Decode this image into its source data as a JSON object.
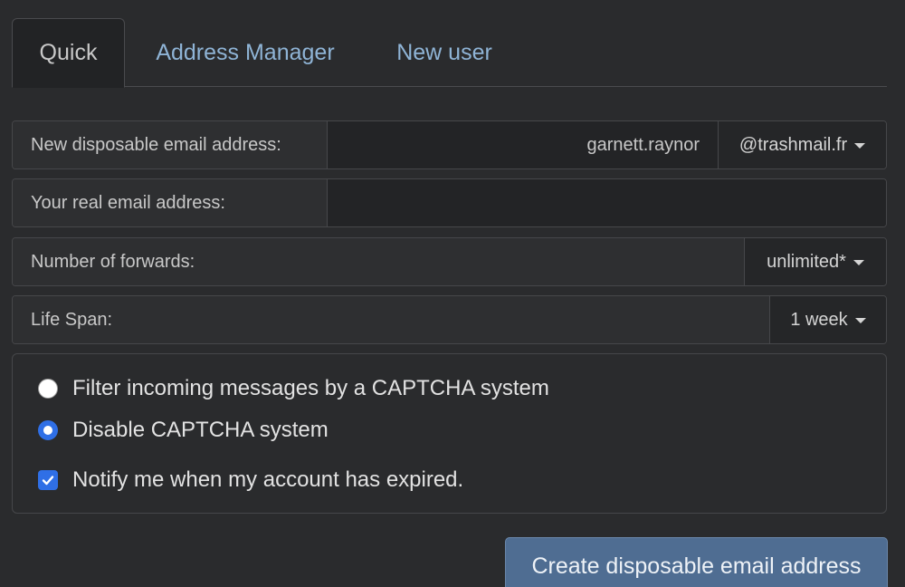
{
  "tabs": [
    {
      "label": "Quick",
      "active": true
    },
    {
      "label": "Address Manager",
      "active": false
    },
    {
      "label": "New user",
      "active": false
    }
  ],
  "form": {
    "disposable": {
      "label": "New disposable email address:",
      "value": "garnett.raynor",
      "domain": "@trashmail.fr"
    },
    "real_email": {
      "label": "Your real email address:",
      "value": "",
      "placeholder": ""
    },
    "forwards": {
      "label": "Number of forwards:",
      "value": "unlimited*"
    },
    "lifespan": {
      "label": "Life Span:",
      "value": "1 week"
    }
  },
  "options": {
    "captcha_filter": {
      "label": "Filter incoming messages by a CAPTCHA system",
      "checked": false
    },
    "captcha_disable": {
      "label": "Disable CAPTCHA system",
      "checked": true
    },
    "notify_expired": {
      "label": "Notify me when my account has expired.",
      "checked": true
    }
  },
  "submit_label": "Create disposable email address",
  "colors": {
    "accent": "#2f6fe6",
    "button": "#4f6d92",
    "link": "#8fb4d6",
    "background": "#2a2b2d"
  }
}
